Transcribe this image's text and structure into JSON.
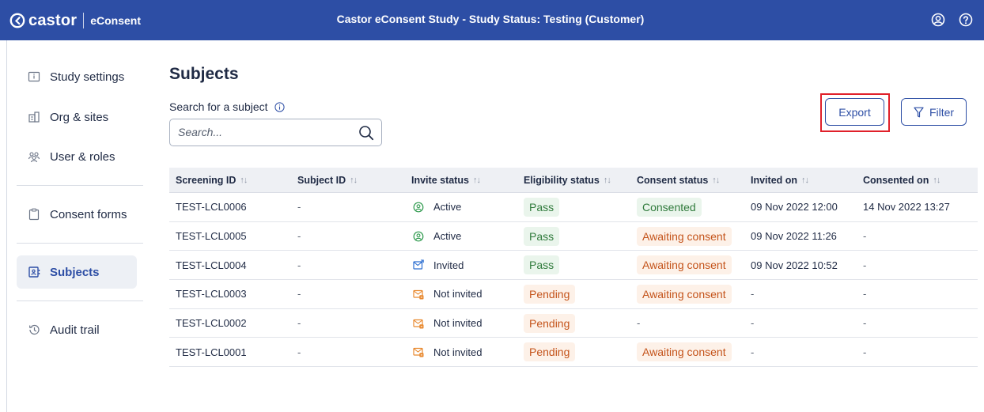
{
  "brand": {
    "name": "castor",
    "product": "eConsent"
  },
  "header": {
    "title": "Castor eConsent Study  - Study Status: Testing (Customer)"
  },
  "sidebar": {
    "items": [
      {
        "label": "Study settings",
        "icon": "info-card-icon"
      },
      {
        "label": "Org & sites",
        "icon": "building-icon"
      },
      {
        "label": "User & roles",
        "icon": "users-icon"
      },
      {
        "label": "Consent forms",
        "icon": "clipboard-icon"
      },
      {
        "label": "Subjects",
        "icon": "contact-book-icon",
        "active": true
      },
      {
        "label": "Audit trail",
        "icon": "history-icon"
      }
    ]
  },
  "page": {
    "title": "Subjects",
    "search_label": "Search for a subject",
    "search_placeholder": "Search...",
    "export_label": "Export",
    "filter_label": "Filter"
  },
  "table": {
    "sort_glyph": "↑↓",
    "headers": [
      "Screening ID",
      "Subject ID",
      "Invite status",
      "Eligibility status",
      "Consent status",
      "Invited on",
      "Consented on"
    ],
    "rows": [
      {
        "screening_id": "TEST-LCL0006",
        "subject_id": "-",
        "invite_status": "Active",
        "invite_icon": "user-circle-icon",
        "eligibility": "Pass",
        "eligibility_color": "green",
        "consent": "Consented",
        "consent_color": "green",
        "invited_on": "09 Nov 2022 12:00",
        "consented_on": "14 Nov 2022 13:27"
      },
      {
        "screening_id": "TEST-LCL0005",
        "subject_id": "-",
        "invite_status": "Active",
        "invite_icon": "user-circle-icon",
        "eligibility": "Pass",
        "eligibility_color": "green",
        "consent": "Awaiting consent",
        "consent_color": "orange",
        "invited_on": "09 Nov 2022 11:26",
        "consented_on": "-"
      },
      {
        "screening_id": "TEST-LCL0004",
        "subject_id": "-",
        "invite_status": "Invited",
        "invite_icon": "mail-sent-icon",
        "eligibility": "Pass",
        "eligibility_color": "green",
        "consent": "Awaiting consent",
        "consent_color": "orange",
        "invited_on": "09 Nov 2022 10:52",
        "consented_on": "-"
      },
      {
        "screening_id": "TEST-LCL0003",
        "subject_id": "-",
        "invite_status": "Not invited",
        "invite_icon": "mail-pending-icon",
        "eligibility": "Pending",
        "eligibility_color": "orange",
        "consent": "Awaiting consent",
        "consent_color": "orange",
        "invited_on": "-",
        "consented_on": "-"
      },
      {
        "screening_id": "TEST-LCL0002",
        "subject_id": "-",
        "invite_status": "Not invited",
        "invite_icon": "mail-pending-icon",
        "eligibility": "Pending",
        "eligibility_color": "orange",
        "consent": "-",
        "consent_color": "none",
        "invited_on": "-",
        "consented_on": "-"
      },
      {
        "screening_id": "TEST-LCL0001",
        "subject_id": "-",
        "invite_status": "Not invited",
        "invite_icon": "mail-pending-icon",
        "eligibility": "Pending",
        "eligibility_color": "orange",
        "consent": "Awaiting consent",
        "consent_color": "orange",
        "invited_on": "-",
        "consented_on": "-"
      }
    ]
  },
  "colors": {
    "brand_blue": "#2d4ea5",
    "pass_green": "#2f7a3b",
    "pending_orange": "#c4531a",
    "highlight_red": "#e0202a"
  }
}
